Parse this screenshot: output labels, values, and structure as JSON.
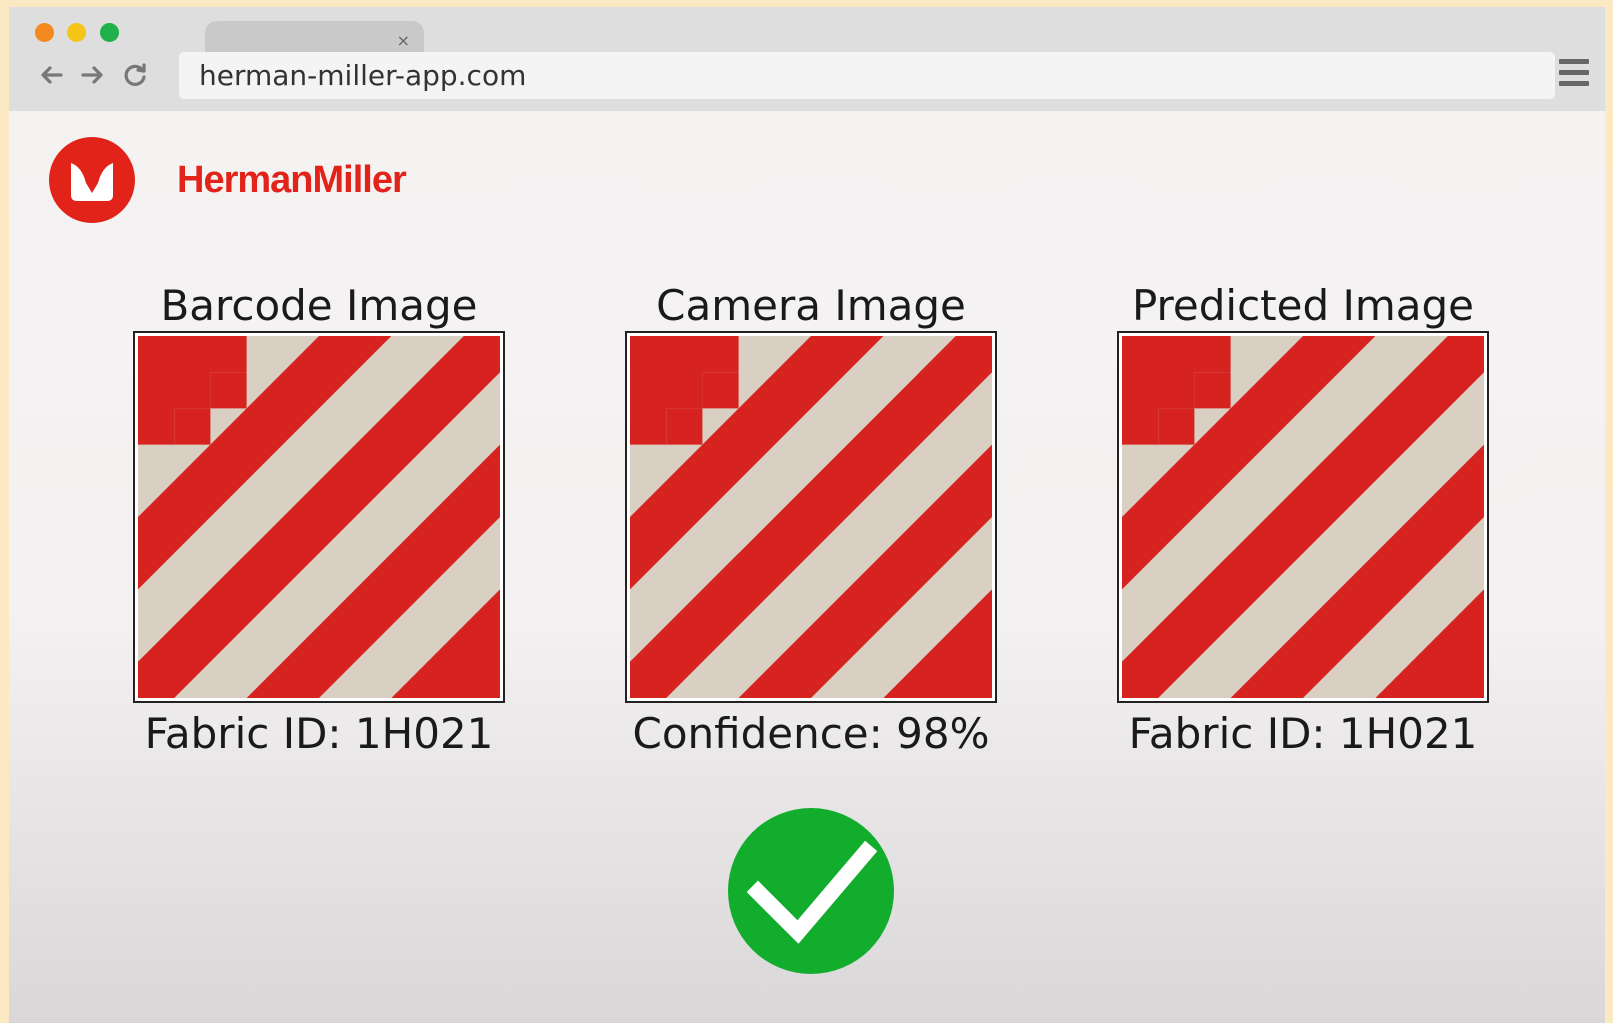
{
  "browser": {
    "url": "herman-miller-app.com",
    "tab_close": "×",
    "icons": [
      "back-arrow-icon",
      "forward-arrow-icon",
      "reload-icon",
      "menu-icon"
    ],
    "window_controls": {
      "close": "#f28a1f",
      "minimize": "#f5c518",
      "maximize": "#20b14a"
    }
  },
  "header": {
    "brand": "HermanMiller",
    "brand_color": "#e2231a"
  },
  "panels": [
    {
      "title": "Barcode Image",
      "caption": "Fabric ID: 1H021"
    },
    {
      "title": "Camera Image",
      "caption": "Confidence: 98%"
    },
    {
      "title": "Predicted Image",
      "caption": "Fabric ID: 1H021"
    }
  ],
  "result": {
    "icon": "checkmark-icon",
    "color": "#13ad2e"
  }
}
